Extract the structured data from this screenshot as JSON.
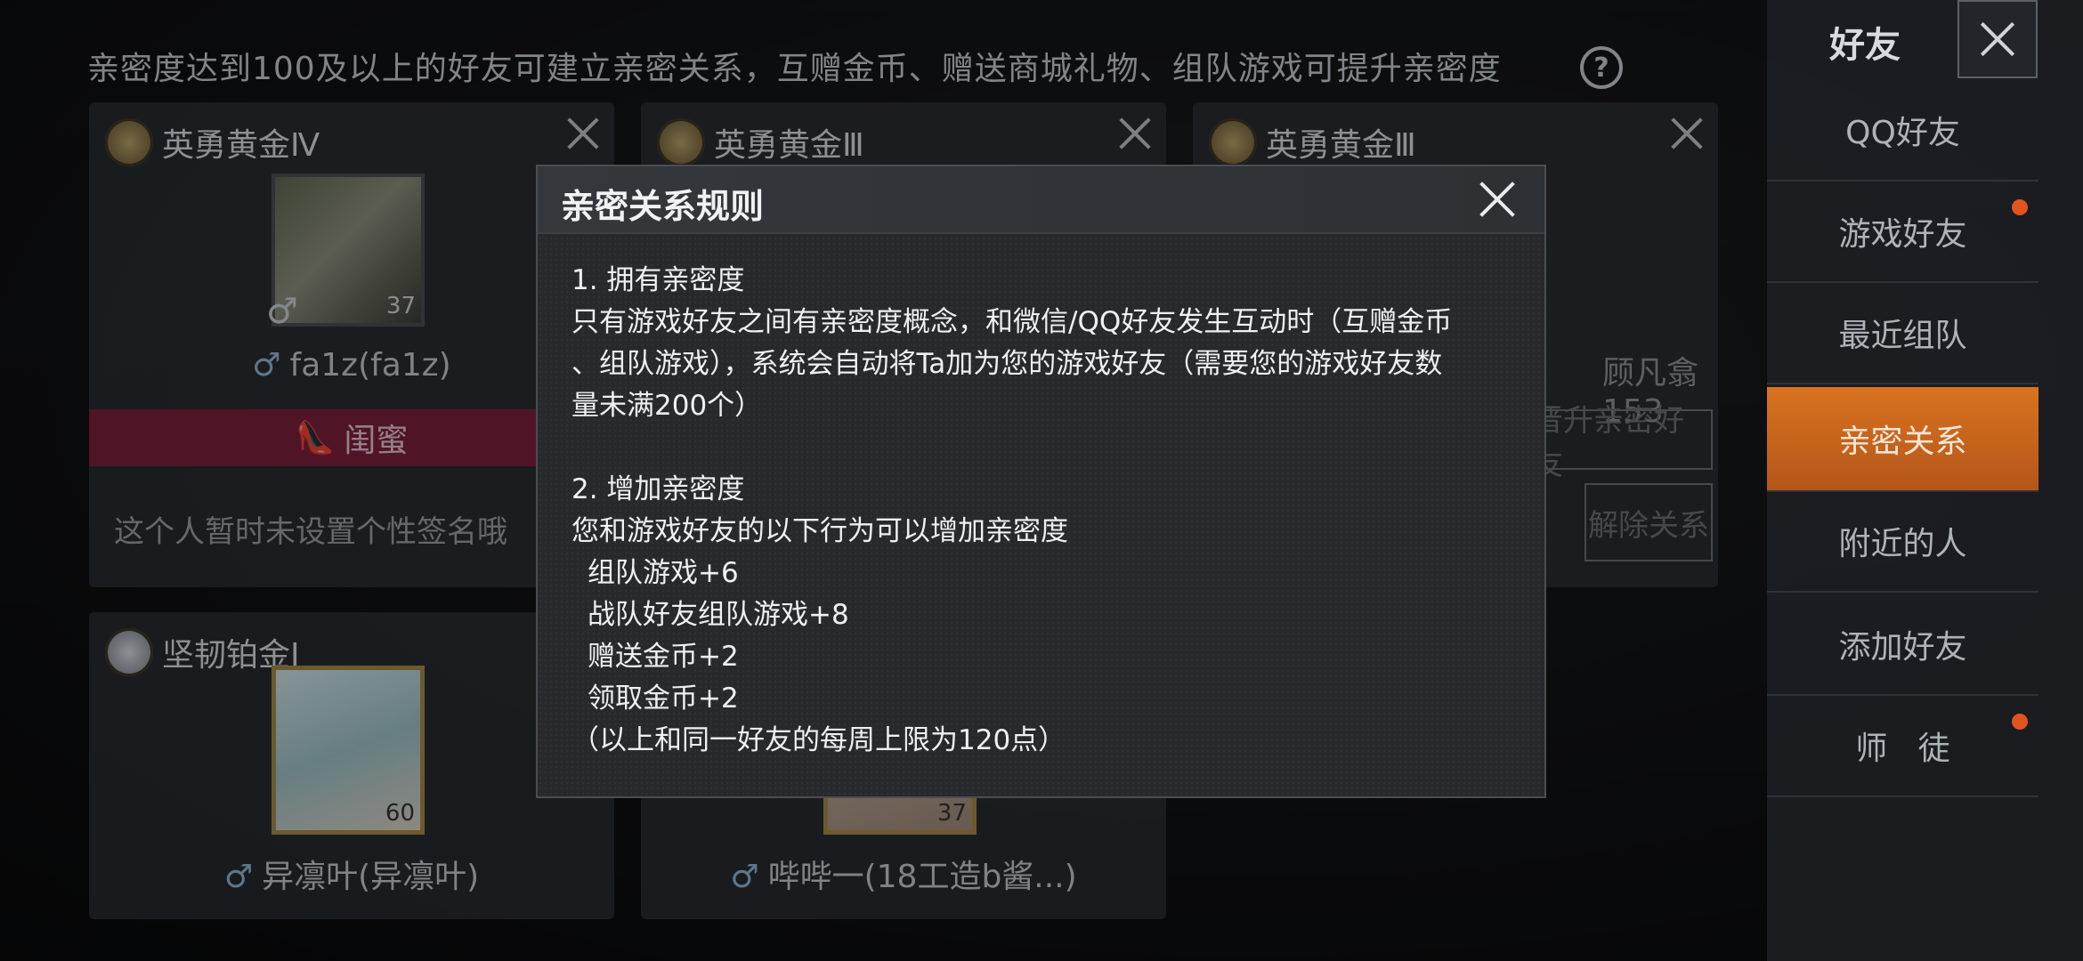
{
  "hint": "亲密度达到100及以上的好友可建立亲密关系，互赠金币、赠送商城礼物、组队游戏可提升亲密度",
  "help_icon": "?",
  "cards": [
    {
      "rank": "英勇黄金Ⅳ",
      "level": "37",
      "name": "fa1z(fa1z)",
      "tag": "闺蜜",
      "signature": "这个人暂时未设置个性签名哦"
    },
    {
      "rank": "英勇黄金Ⅲ"
    },
    {
      "rank": "英勇黄金Ⅲ",
      "name_partial": "顾凡翕153",
      "btn1": "晋升亲密好友",
      "btn2": "解除关系"
    },
    {
      "rank": "坚韧铂金Ⅰ",
      "level": "60",
      "name": "异凛叶(异凛叶)"
    },
    {
      "level": "37",
      "name": "哔哔一(18工造b酱...)"
    }
  ],
  "sidebar": {
    "title": "好友",
    "items": [
      {
        "label": "QQ好友"
      },
      {
        "label": "游戏好友"
      },
      {
        "label": "最近组队"
      },
      {
        "label": "亲密关系"
      },
      {
        "label": "附近的人"
      },
      {
        "label": "添加好友"
      },
      {
        "label": "师   徒"
      }
    ]
  },
  "modal": {
    "title": "亲密关系规则",
    "s1_title": "1. 拥有亲密度",
    "s1_l1": "只有游戏好友之间有亲密度概念，和微信/QQ好友发生互动时（互赠金币",
    "s1_l2": "、组队游戏），系统会自动将Ta加为您的游戏好友（需要您的游戏好友数",
    "s1_l3": "量未满200个）",
    "s2_title": "2. 增加亲密度",
    "s2_l1": "您和游戏好友的以下行为可以增加亲密度",
    "r1": "组队游戏+6",
    "r2": "战队好友组队游戏+8",
    "r3": "赠送金币+2",
    "r4": "领取金币+2",
    "note": "（以上和同一好友的每周上限为120点）"
  }
}
